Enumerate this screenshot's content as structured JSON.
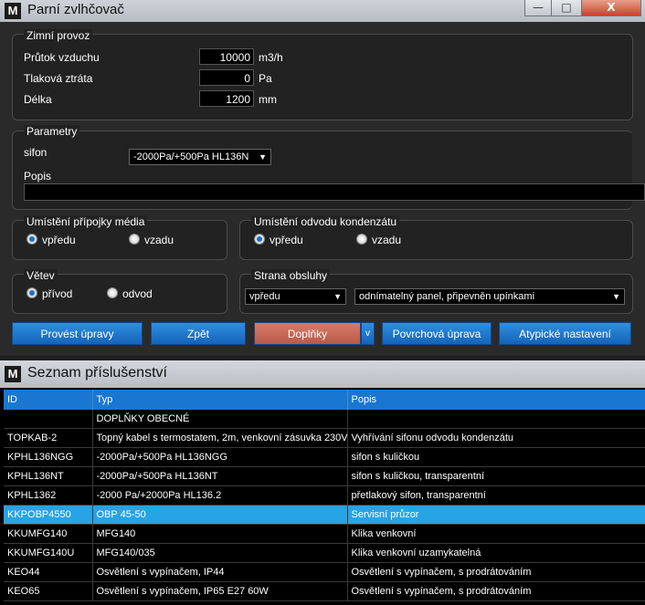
{
  "window1": {
    "title": "Parní zvlhčovač",
    "icon_letter": "M",
    "controls": {
      "minimize": "—",
      "maximize": "□",
      "close": "X"
    },
    "winter": {
      "legend": "Zimní provoz",
      "rows": [
        {
          "label": "Průtok vzduchu",
          "value": "10000",
          "unit": "m3/h"
        },
        {
          "label": "Tlaková ztráta",
          "value": "0",
          "unit": "Pa"
        },
        {
          "label": "Délka",
          "value": "1200",
          "unit": "mm"
        }
      ]
    },
    "params": {
      "legend": "Parametry",
      "sifon_label": "sifon",
      "sifon_value": "-2000Pa/+500Pa  HL136N",
      "popis_label": "Popis",
      "popis_value": ""
    },
    "media": {
      "legend": "Umístění přípojky média",
      "options": [
        "vpředu",
        "vzadu"
      ],
      "selected": "vpředu"
    },
    "condensate": {
      "legend": "Umístění odvodu kondenzátu",
      "options": [
        "vpředu",
        "vzadu"
      ],
      "selected": "vpředu"
    },
    "branch": {
      "legend": "Větev",
      "options": [
        "přívod",
        "odvod"
      ],
      "selected": "přívod"
    },
    "service": {
      "legend": "Strana obsluhy",
      "side_value": "vpředu",
      "panel_value": "odnímatelný panel, připevněn upínkami"
    },
    "buttons": {
      "apply": "Provést úpravy",
      "back": "Zpět",
      "accessories": "Doplňky",
      "accessories_drop": "v",
      "surface": "Povrchová úprava",
      "atypical": "Atypické nastavení"
    }
  },
  "window2": {
    "title": "Seznam příslušenství",
    "icon_letter": "M",
    "columns": [
      "ID",
      "Typ",
      "Popis"
    ],
    "rows": [
      {
        "id": "",
        "typ": "DOPLŇKY OBECNÉ",
        "popis": ""
      },
      {
        "id": "TOPKAB-2",
        "typ": "Topný kabel s termostatem, 2m, venkovní zásuvka 230V",
        "popis": "Vyhřívání sifonu odvodu kondenzátu"
      },
      {
        "id": "KPHL136NGG",
        "typ": "-2000Pa/+500Pa  HL136NGG",
        "popis": "sifon s kuličkou"
      },
      {
        "id": "KPHL136NT",
        "typ": "-2000Pa/+500Pa  HL136NT",
        "popis": "sifon s kuličkou, transparentní"
      },
      {
        "id": "KPHL1362",
        "typ": "-2000 Pa/+2000Pa  HL136.2",
        "popis": "přetlakový sifon, transparentní"
      },
      {
        "id": "KKPOBP4550",
        "typ": "OBP 45-50",
        "popis": "Servisní průzor"
      },
      {
        "id": "KKUMFG140",
        "typ": "MFG140",
        "popis": "Klika venkovní"
      },
      {
        "id": "KKUMFG140U",
        "typ": "MFG140/035",
        "popis": "Klika venkovní uzamykatelná"
      },
      {
        "id": "KEO44",
        "typ": "Osvětlení s vypínačem,  IP44",
        "popis": "Osvětlení s vypínačem,  s prodrátováním"
      },
      {
        "id": "KEO65",
        "typ": "Osvětlení s vypínačem,  IP65  E27  60W",
        "popis": "Osvětlení s vypínačem,  s prodrátováním"
      }
    ],
    "selected_row": 5
  },
  "colors": {
    "accent": "#1977d2",
    "selection": "#28a3e4",
    "active_button": "#c96a58"
  }
}
